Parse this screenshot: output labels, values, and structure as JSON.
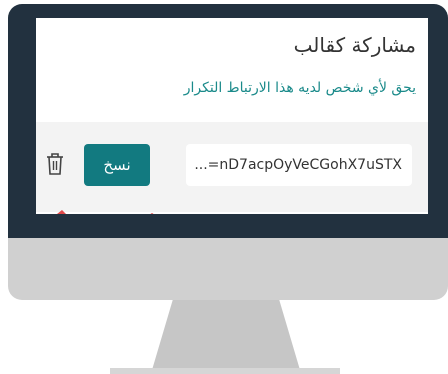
{
  "dialog": {
    "title": "مشاركة كقالب",
    "subtitle": "يحق لأي شخص لديه هذا الارتباط التكرار",
    "link_value": "...=nD7acpOyVeCGohX7uSTX",
    "copy_label": "نسخ"
  },
  "icons": {
    "delete": "trash-icon"
  },
  "colors": {
    "bezel": "#22313f",
    "chin": "#d0d0d0",
    "accent": "#127a80",
    "link_text": "#1a8a8a"
  }
}
